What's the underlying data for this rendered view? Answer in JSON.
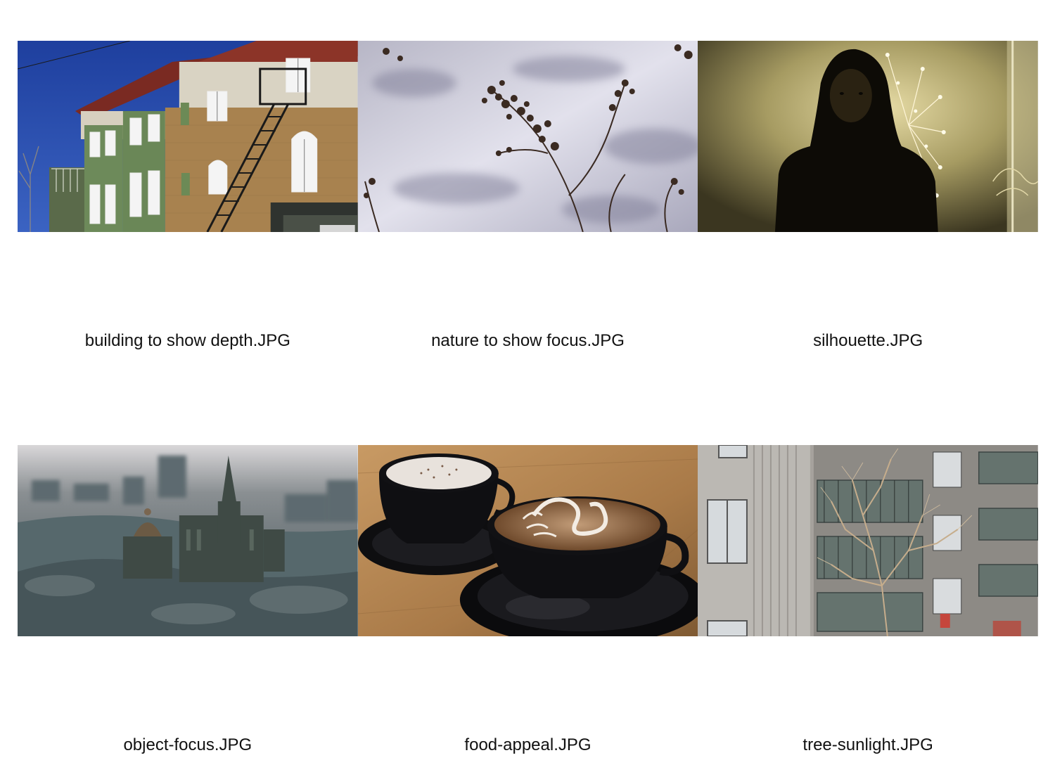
{
  "gallery": {
    "items": [
      {
        "name": "building to show depth.JPG",
        "image": "building-photo"
      },
      {
        "name": "nature to show focus.JPG",
        "image": "nature-photo"
      },
      {
        "name": "silhouette.JPG",
        "image": "silhouette-photo"
      },
      {
        "name": "object-focus.JPG",
        "image": "object-photo"
      },
      {
        "name": "food-appeal.JPG",
        "image": "coffee-photo"
      },
      {
        "name": "tree-sunlight.JPG",
        "image": "tree-photo"
      }
    ]
  }
}
